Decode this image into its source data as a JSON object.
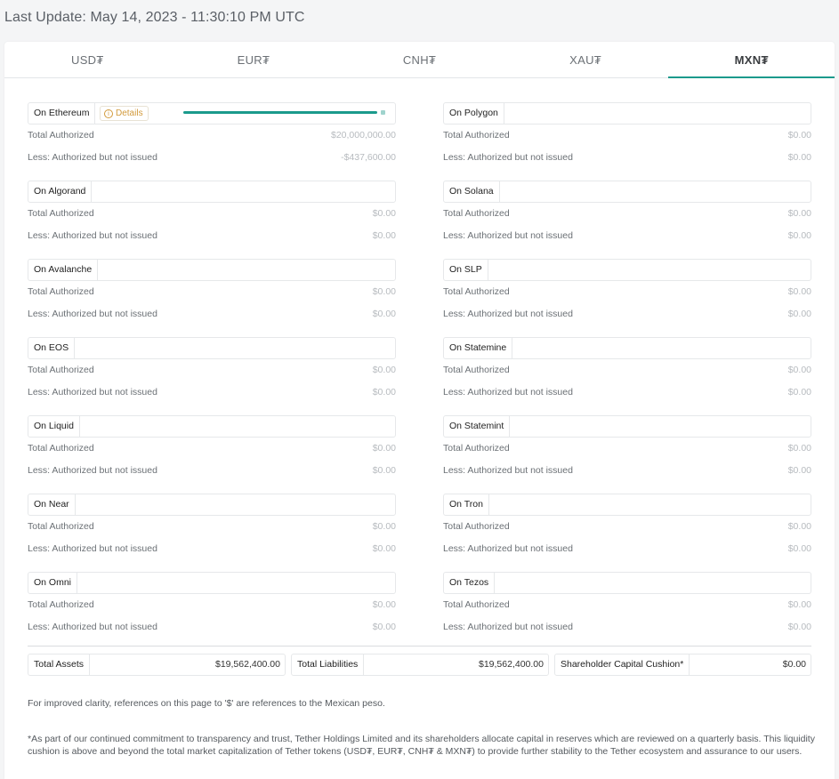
{
  "last_update": "Last Update: May 14, 2023 - 11:30:10 PM UTC",
  "tabs": [
    {
      "label": "USD₮"
    },
    {
      "label": "EUR₮"
    },
    {
      "label": "CNH₮"
    },
    {
      "label": "XAU₮"
    },
    {
      "label": "MXN₮"
    }
  ],
  "active_tab": "MXN₮",
  "labels": {
    "total_authorized": "Total Authorized",
    "less_not_issued": "Less: Authorized but not issued",
    "details": "Details"
  },
  "chains_left": [
    {
      "name": "On Ethereum",
      "total": "$20,000,000.00",
      "less": "-$437,600.00",
      "has_details": true,
      "issued_fraction": 0.978
    },
    {
      "name": "On Algorand",
      "total": "$0.00",
      "less": "$0.00"
    },
    {
      "name": "On Avalanche",
      "total": "$0.00",
      "less": "$0.00"
    },
    {
      "name": "On EOS",
      "total": "$0.00",
      "less": "$0.00"
    },
    {
      "name": "On Liquid",
      "total": "$0.00",
      "less": "$0.00"
    },
    {
      "name": "On Near",
      "total": "$0.00",
      "less": "$0.00"
    },
    {
      "name": "On Omni",
      "total": "$0.00",
      "less": "$0.00"
    }
  ],
  "chains_right": [
    {
      "name": "On Polygon",
      "total": "$0.00",
      "less": "$0.00"
    },
    {
      "name": "On Solana",
      "total": "$0.00",
      "less": "$0.00"
    },
    {
      "name": "On SLP",
      "total": "$0.00",
      "less": "$0.00"
    },
    {
      "name": "On Statemine",
      "total": "$0.00",
      "less": "$0.00"
    },
    {
      "name": "On Statemint",
      "total": "$0.00",
      "less": "$0.00"
    },
    {
      "name": "On Tron",
      "total": "$0.00",
      "less": "$0.00"
    },
    {
      "name": "On Tezos",
      "total": "$0.00",
      "less": "$0.00"
    }
  ],
  "summary": {
    "total_assets_label": "Total Assets",
    "total_assets_value": "$19,562,400.00",
    "total_liabilities_label": "Total Liabilities",
    "total_liabilities_value": "$19,562,400.00",
    "cushion_label": "Shareholder Capital Cushion*",
    "cushion_value": "$0.00"
  },
  "notes": {
    "clarity": "For improved clarity, references on this page to '$' are references to the Mexican peso.",
    "cushion": "*As part of our continued commitment to transparency and trust, Tether Holdings Limited and its shareholders allocate capital in reserves which are reviewed on a quarterly basis. This liquidity cushion is above and beyond the total market capitalization of Tether tokens (USD₮, EUR₮, CNH₮ & MXN₮) to provide further stability to the Tether ecosystem and assurance to our users."
  },
  "colors": {
    "accent": "#1b9a8c",
    "details": "#d29a3c"
  }
}
